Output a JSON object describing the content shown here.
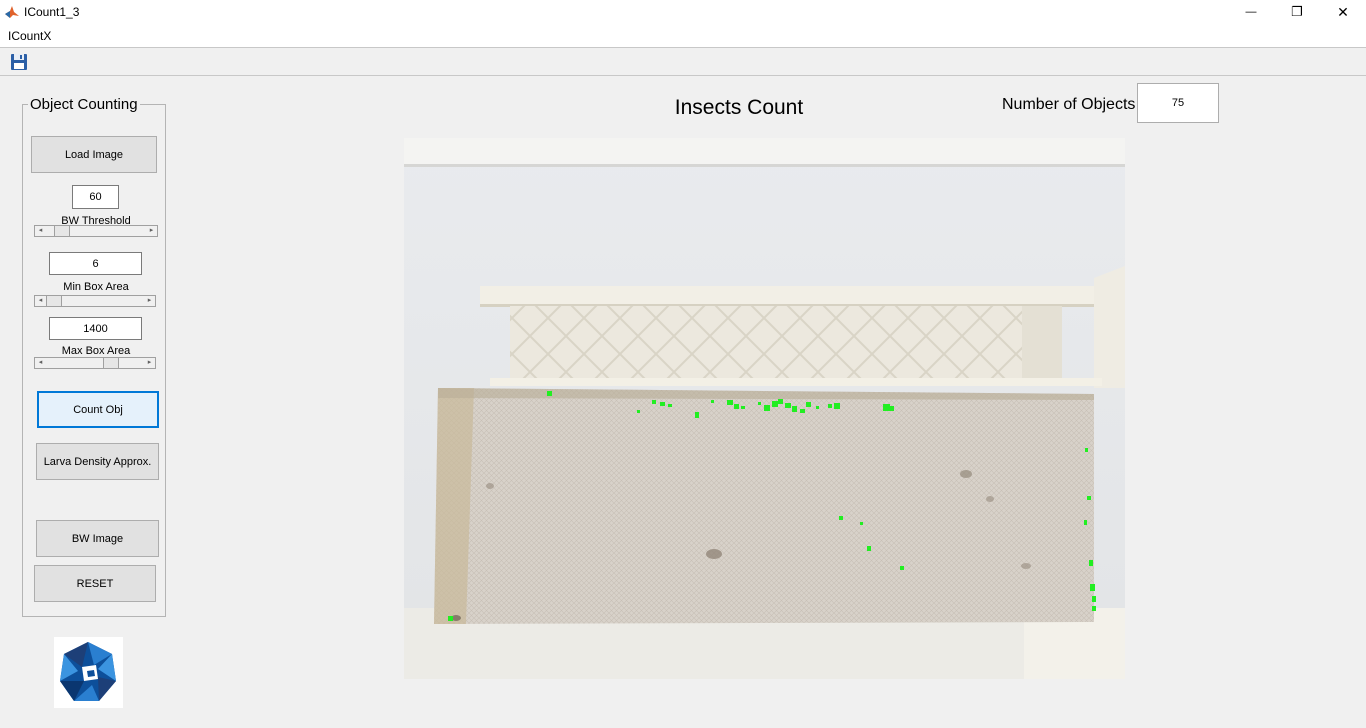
{
  "window": {
    "title": "ICount1_3",
    "minimize_glyph": "—",
    "restore_glyph": "❐",
    "close_glyph": "✕"
  },
  "menu": {
    "items": [
      "ICountX"
    ]
  },
  "toolbar": {
    "save_icon": "save-icon"
  },
  "panel": {
    "title": "Object Counting",
    "load_image": "Load Image",
    "bw_threshold_value": "60",
    "bw_threshold_label": "BW Threshold",
    "bw_threshold_level": 0.1,
    "min_box_value": "6",
    "min_box_label": "Min Box Area",
    "min_box_level": 0.0,
    "max_box_value": "1400",
    "max_box_label": "Max Box Area",
    "max_box_level": 0.7,
    "count_obj": "Count Obj",
    "larva_density": "Larva Density Approx.",
    "bw_image": "BW Image",
    "reset": "RESET"
  },
  "main": {
    "title": "Insects Count",
    "number_label": "Number of Objects",
    "number_value": "75"
  },
  "colors": {
    "accent": "#0078d7",
    "detection": "#22ee22",
    "logo_blue": "#0d4f9a"
  }
}
